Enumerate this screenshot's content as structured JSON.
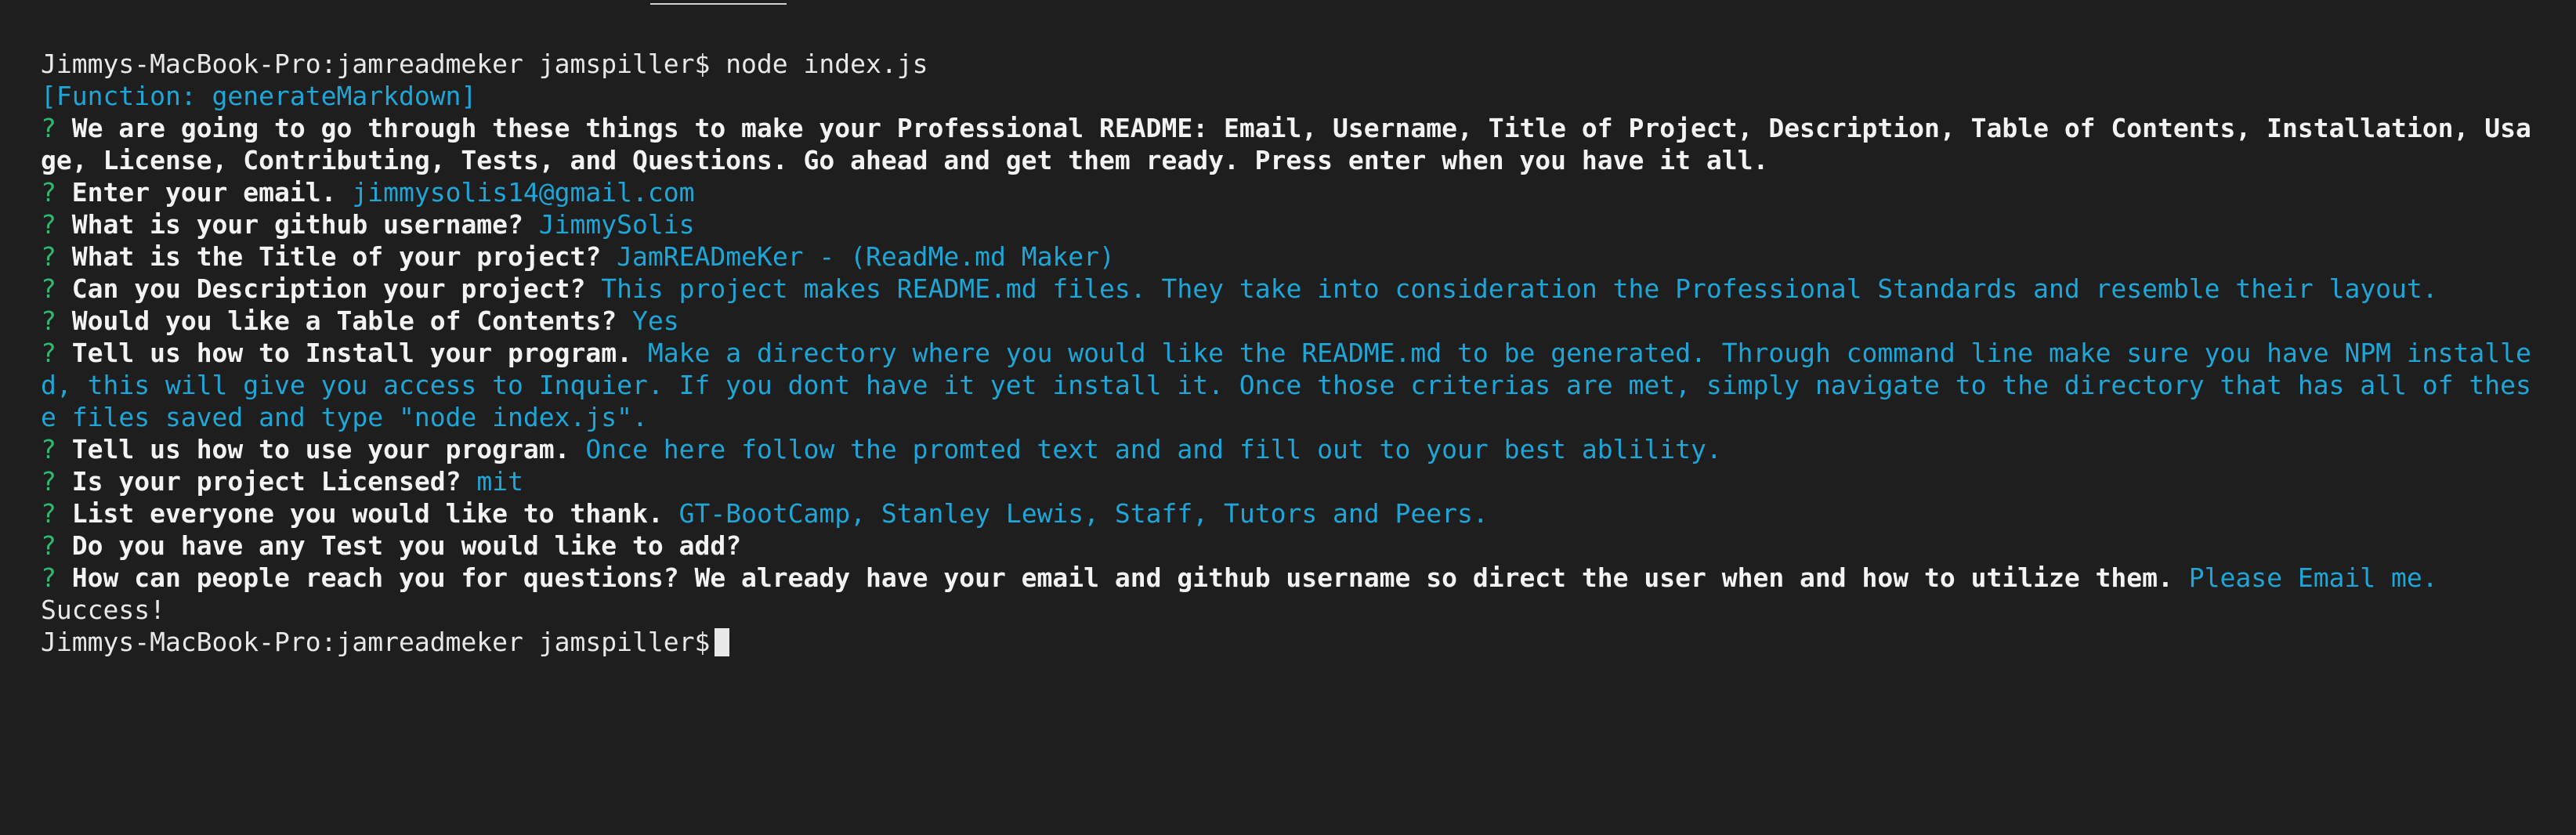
{
  "terminal": {
    "prompt": "Jimmys-MacBook-Pro:jamreadmeker jamspiller$ ",
    "command": "node index.js",
    "function_output": "[Function: generateMarkdown]",
    "qmark": "?",
    "intro_text": "We are going to go through these things to make your Professional README: Email, Username, Title of Project, Description, Table of Contents, Installation, Usage, License, Contributing, Tests, and Questions. Go ahead and get them ready. Press enter when you have it all.",
    "questions": [
      {
        "q": "Enter your email.",
        "a": "jimmysolis14@gmail.com"
      },
      {
        "q": "What is your github username?",
        "a": "JimmySolis"
      },
      {
        "q": "What is the Title of your project?",
        "a": "JamREADmeKer - (ReadMe.md Maker)"
      },
      {
        "q": "Can you Description your project?",
        "a": "This project makes README.md files. They take into consideration the Professional Standards and resemble their layout."
      },
      {
        "q": "Would you like a Table of Contents?",
        "a": "Yes"
      },
      {
        "q": "Tell us how to Install your program.",
        "a": "Make a directory where you would like the README.md to be generated. Through command line make sure you have NPM installed, this will give you access to Inquier. If you dont have it yet install it. Once those criterias are met, simply navigate to the directory that has all of these files saved and type \"node index.js\"."
      },
      {
        "q": "Tell us how to use your program.",
        "a": "Once here follow the promted text and and fill out to your best ablility."
      },
      {
        "q": "Is your project Licensed?",
        "a": "mit"
      },
      {
        "q": "List everyone you would like to thank.",
        "a": "GT-BootCamp, Stanley Lewis, Staff, Tutors and Peers."
      },
      {
        "q": "Do you have any Test you would like to add?",
        "a": ""
      },
      {
        "q": "How can people reach you for questions? We already have your email and github username so direct the user when and how to utilize them.",
        "a": "Please Email me."
      }
    ],
    "success": "Success!",
    "final_prompt": "Jimmys-MacBook-Pro:jamreadmeker jamspiller$"
  },
  "colors": {
    "background": "#1e1e1e",
    "text": "#e8e8e8",
    "answer": "#1fa5d6",
    "question_mark": "#2fb86f"
  }
}
